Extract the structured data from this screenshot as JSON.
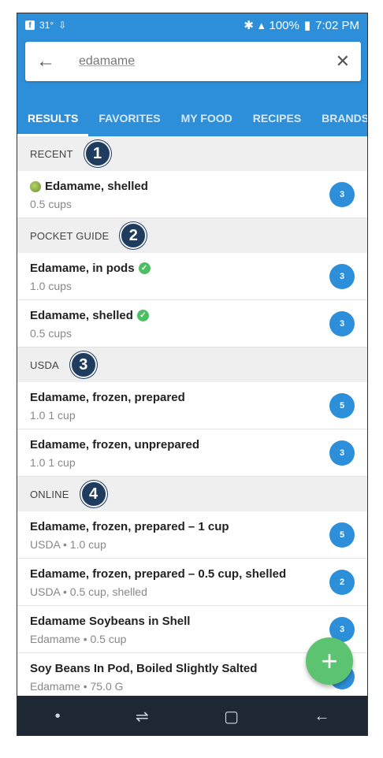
{
  "status": {
    "left_text": "31°",
    "battery": "100%",
    "time": "7:02 PM"
  },
  "search": {
    "query": "edamame"
  },
  "tabs": [
    "RESULTS",
    "FAVORITES",
    "MY FOOD",
    "RECIPES",
    "BRANDS"
  ],
  "sections": [
    {
      "title": "RECENT",
      "callout": "1",
      "items": [
        {
          "name": "Edamame, shelled",
          "sub": "0.5 cups",
          "badge": "3",
          "icon": "fruit-icon"
        }
      ]
    },
    {
      "title": "POCKET GUIDE",
      "callout": "2",
      "items": [
        {
          "name": "Edamame, in pods",
          "sub": "1.0 cups",
          "badge": "3",
          "icon": "check-icon"
        },
        {
          "name": "Edamame, shelled",
          "sub": "0.5 cups",
          "badge": "3",
          "icon": "check-icon"
        }
      ]
    },
    {
      "title": "USDA",
      "callout": "3",
      "items": [
        {
          "name": "Edamame, frozen, prepared",
          "sub": "1.0 1 cup",
          "badge": "5"
        },
        {
          "name": "Edamame, frozen, unprepared",
          "sub": "1.0 1 cup",
          "badge": "3"
        }
      ]
    },
    {
      "title": "ONLINE",
      "callout": "4",
      "items": [
        {
          "name": "Edamame, frozen, prepared – 1 cup",
          "sub": "USDA • 1.0 cup",
          "badge": "5"
        },
        {
          "name": "Edamame, frozen, prepared – 0.5 cup, shelled",
          "sub": "USDA • 0.5 cup, shelled",
          "badge": "2"
        },
        {
          "name": "Edamame Soybeans in Shell",
          "sub": "Edamame • 0.5 cup",
          "badge": "3"
        },
        {
          "name": "Soy Beans In Pod, Boiled Slightly Salted",
          "sub": "Edamame • 75.0 G",
          "badge": ""
        }
      ]
    }
  ],
  "colors": {
    "primary": "#2d8fd9",
    "fab": "#5cc470",
    "check": "#4cbf63",
    "callout": "#1f3b5e"
  }
}
